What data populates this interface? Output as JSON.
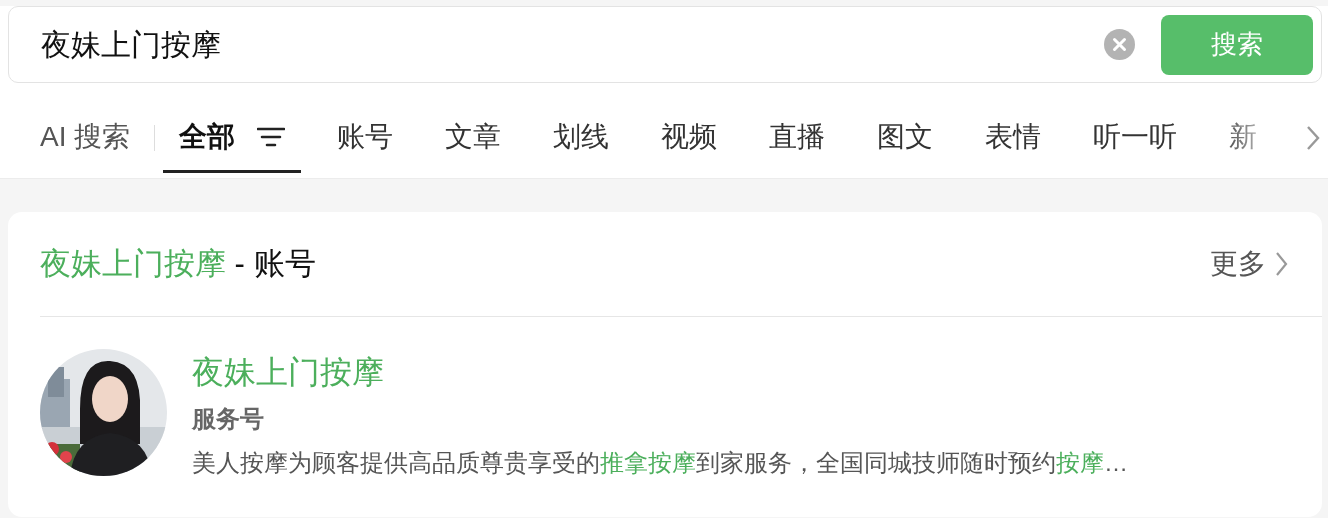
{
  "search": {
    "value": "夜妹上门按摩",
    "button": "搜索"
  },
  "tabs": [
    {
      "label": "AI 搜索",
      "kind": "ai",
      "selected": false
    },
    {
      "label": "全部",
      "kind": "filter",
      "selected": true
    },
    {
      "label": "账号",
      "kind": "plain",
      "selected": false
    },
    {
      "label": "文章",
      "kind": "plain",
      "selected": false
    },
    {
      "label": "划线",
      "kind": "plain",
      "selected": false
    },
    {
      "label": "视频",
      "kind": "plain",
      "selected": false
    },
    {
      "label": "直播",
      "kind": "plain",
      "selected": false
    },
    {
      "label": "图文",
      "kind": "plain",
      "selected": false
    },
    {
      "label": "表情",
      "kind": "plain",
      "selected": false
    },
    {
      "label": "听一听",
      "kind": "plain",
      "selected": false
    },
    {
      "label": "新",
      "kind": "plain",
      "selected": false
    }
  ],
  "section": {
    "title": "**夜妹上门按摩** - 账号",
    "more": "更多"
  },
  "accounts": [
    {
      "name": "夜妹上门按摩",
      "type": "服务号",
      "description": "美人按摩为顾客提供高品质尊贵享受的**推拿按摩**到家服务，全国同城技师随时预约**按摩**…"
    }
  ]
}
